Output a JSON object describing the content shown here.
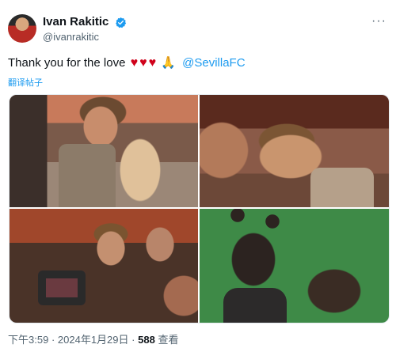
{
  "author": {
    "display_name": "Ivan Rakitic",
    "handle": "@ivanrakitic",
    "verified_color": "#1d9bf0"
  },
  "more_label": "···",
  "tweet": {
    "text": "Thank you for the love",
    "heart": "♥",
    "hands": "🙏",
    "mention": "@SevillaFC",
    "translate_label": "翻译帖子"
  },
  "photos": [
    {
      "icon": "photo-stadium-stands"
    },
    {
      "icon": "photo-fans-greeting"
    },
    {
      "icon": "photo-press-crowd"
    },
    {
      "icon": "photo-child-pitch"
    }
  ],
  "meta": {
    "time": "下午3:59",
    "sep": "·",
    "date": "2024年1月29日",
    "views_count": "588",
    "views_label": "查看"
  },
  "colors": {
    "link": "#1d9bf0",
    "heart": "#d0021b",
    "muted": "#536471"
  }
}
